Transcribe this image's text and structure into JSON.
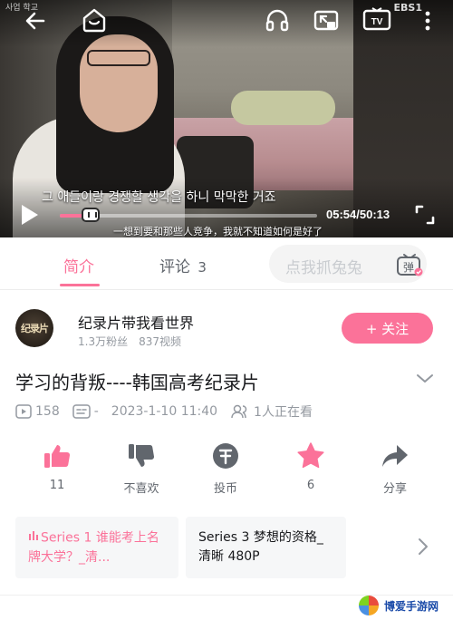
{
  "video": {
    "subtitle_korean": "그 애들이랑 경쟁할 생각을 하니 막막한 거죠",
    "subtitle_chinese": "一想到要和那些人竞争，我就不知道如何是好了",
    "time": "05:54/50:13",
    "progress_fraction": 0.118,
    "channel_logo": "EBS1",
    "corner_text": "사업 학교"
  },
  "tabs": {
    "intro": "简介",
    "comments_label": "评论",
    "comments_count": "3",
    "danmaku_placeholder": "点我抓兔兔",
    "danmaku_btn": "弹"
  },
  "uploader": {
    "avatar_text": "纪录片",
    "name": "纪录片带我看世界",
    "followers": "1.3万粉丝",
    "videos": "837视频",
    "follow_label": "+ 关注"
  },
  "video_info": {
    "title": "学习的背叛----韩国高考纪录片",
    "views": "158",
    "danmaku": "-",
    "datetime": "2023-1-10 11:40",
    "watching": "1人正在看"
  },
  "actions": {
    "like": "11",
    "dislike": "不喜欢",
    "coin": "投币",
    "favorite": "6",
    "share": "分享"
  },
  "series": [
    {
      "title": "Series 1 谁能考上名牌大学？_清..."
    },
    {
      "title": "Series 3 梦想的资格_清晰 480P"
    }
  ],
  "watermark": "博爱手游网",
  "colors": {
    "accent": "#fb7299",
    "text_primary": "#18191c",
    "text_secondary": "#9499a0"
  }
}
